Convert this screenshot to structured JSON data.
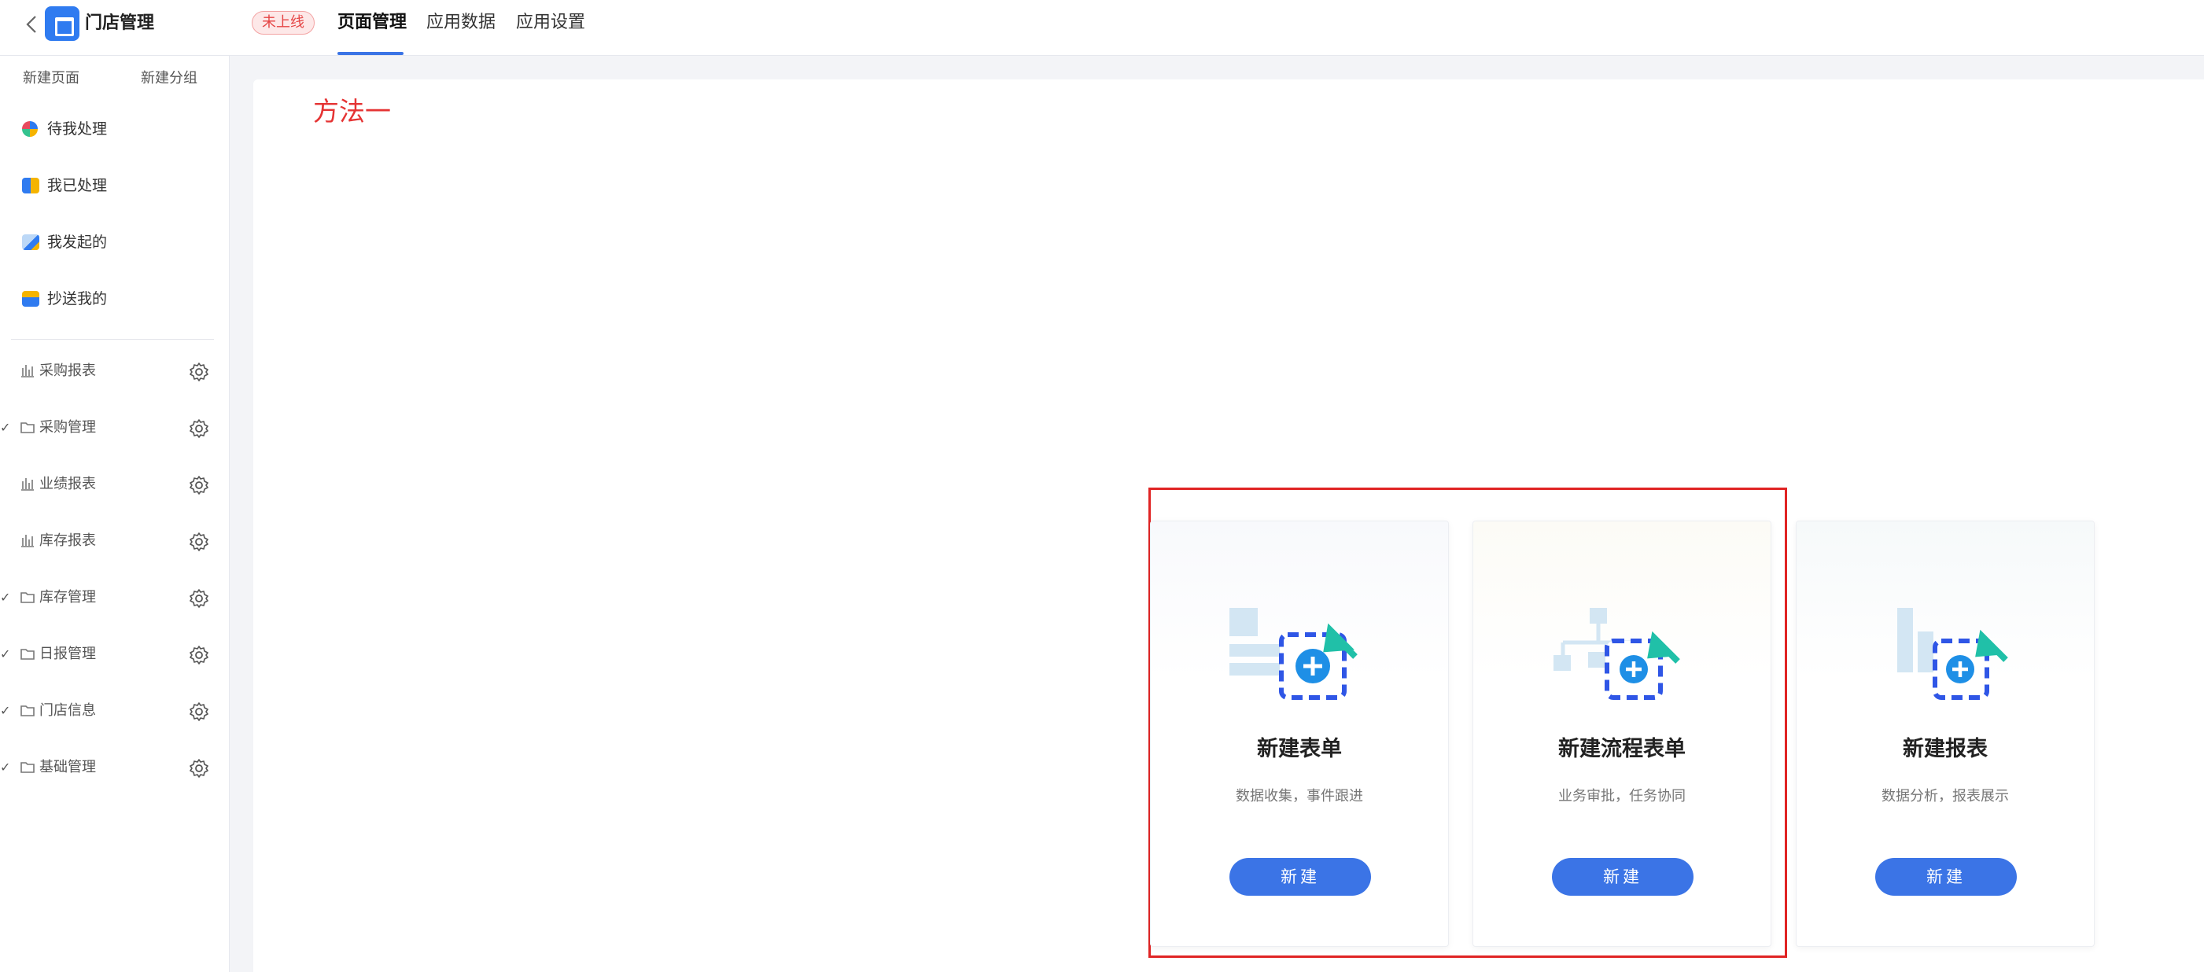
{
  "header": {
    "app_name": "门店管理",
    "status_badge": "未上线",
    "tabs": [
      {
        "label": "页面管理",
        "active": true
      },
      {
        "label": "应用数据",
        "active": false
      },
      {
        "label": "应用设置",
        "active": false
      }
    ]
  },
  "sidebar": {
    "new_page": "新建页面",
    "new_group": "新建分组",
    "quick_items": [
      {
        "label": "待我处理",
        "icon": "pending-icon"
      },
      {
        "label": "我已处理",
        "icon": "done-icon"
      },
      {
        "label": "我发起的",
        "icon": "initiated-icon"
      },
      {
        "label": "抄送我的",
        "icon": "cc-icon"
      }
    ],
    "pages": [
      {
        "label": "采购报表",
        "type": "report",
        "expandable": false
      },
      {
        "label": "采购管理",
        "type": "folder",
        "expandable": true
      },
      {
        "label": "业绩报表",
        "type": "report",
        "expandable": false
      },
      {
        "label": "库存报表",
        "type": "report",
        "expandable": false
      },
      {
        "label": "库存管理",
        "type": "folder",
        "expandable": true
      },
      {
        "label": "日报管理",
        "type": "folder",
        "expandable": true
      },
      {
        "label": "门店信息",
        "type": "folder",
        "expandable": true
      },
      {
        "label": "基础管理",
        "type": "folder",
        "expandable": true
      }
    ]
  },
  "main": {
    "annotation": "方法一",
    "cards": [
      {
        "title": "新建表单",
        "desc": "数据收集，事件跟进",
        "button": "新建"
      },
      {
        "title": "新建流程表单",
        "desc": "业务审批，任务协同",
        "button": "新建"
      },
      {
        "title": "新建报表",
        "desc": "数据分析，报表展示",
        "button": "新建"
      }
    ]
  },
  "colors": {
    "accent": "#3b74e6",
    "annotation": "#e53333",
    "highlight_border": "#e02424",
    "badge_text": "#e54545",
    "arrow": "#20c0a8",
    "plus": "#1e8fe6"
  }
}
